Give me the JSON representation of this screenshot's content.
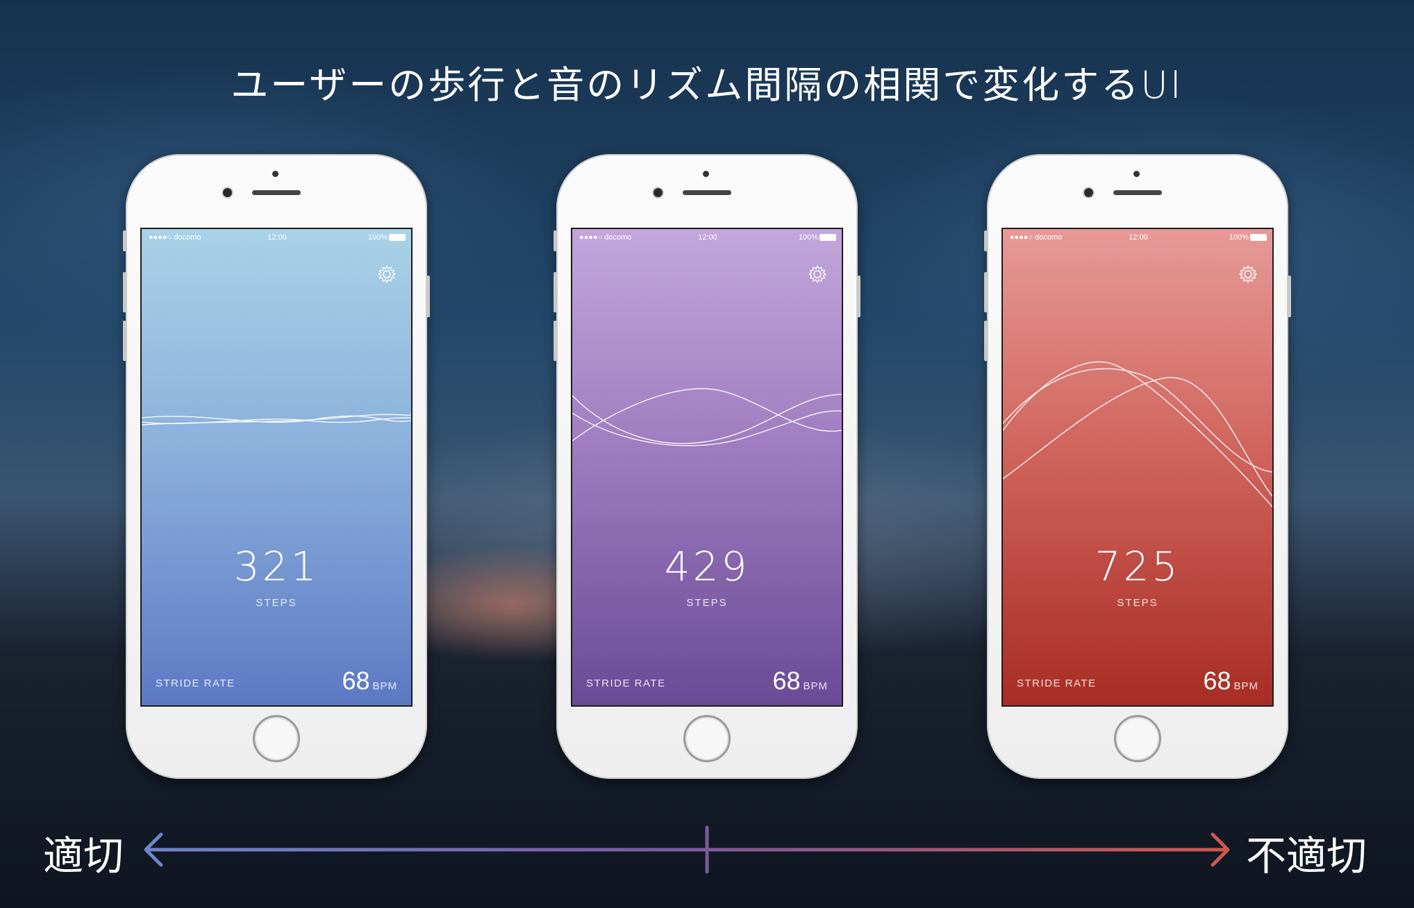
{
  "headline": "ユーザーの歩行と音のリズム間隔の相関で変化するUI",
  "phones": [
    {
      "theme": "blue",
      "status": {
        "carrier": "●●●●○ docomo",
        "time": "12:00",
        "battery": "100%"
      },
      "steps_count": "321",
      "steps_label": "STEPS",
      "stride_label": "STRIDE RATE",
      "bpm_value": "68",
      "bpm_unit": "BPM",
      "colors": {
        "top": "#a9d2e6",
        "bottom": "#5d78c4"
      }
    },
    {
      "theme": "purple",
      "status": {
        "carrier": "●●●●○ docomo",
        "time": "12:00",
        "battery": "100%"
      },
      "steps_count": "429",
      "steps_label": "STEPS",
      "stride_label": "STRIDE RATE",
      "bpm_value": "68",
      "bpm_unit": "BPM",
      "colors": {
        "top": "#c3a6dc",
        "bottom": "#6a4a96"
      }
    },
    {
      "theme": "red",
      "status": {
        "carrier": "●●●●○ docomo",
        "time": "12:00",
        "battery": "100%"
      },
      "steps_count": "725",
      "steps_label": "STEPS",
      "stride_label": "STRIDE RATE",
      "bpm_value": "68",
      "bpm_unit": "BPM",
      "colors": {
        "top": "#e79a98",
        "bottom": "#a82d24"
      }
    }
  ],
  "scale": {
    "left_label": "適切",
    "right_label": "不適切",
    "colors": {
      "left": "#6d87c9",
      "middle": "#7a5a9a",
      "right": "#d0584f"
    }
  }
}
